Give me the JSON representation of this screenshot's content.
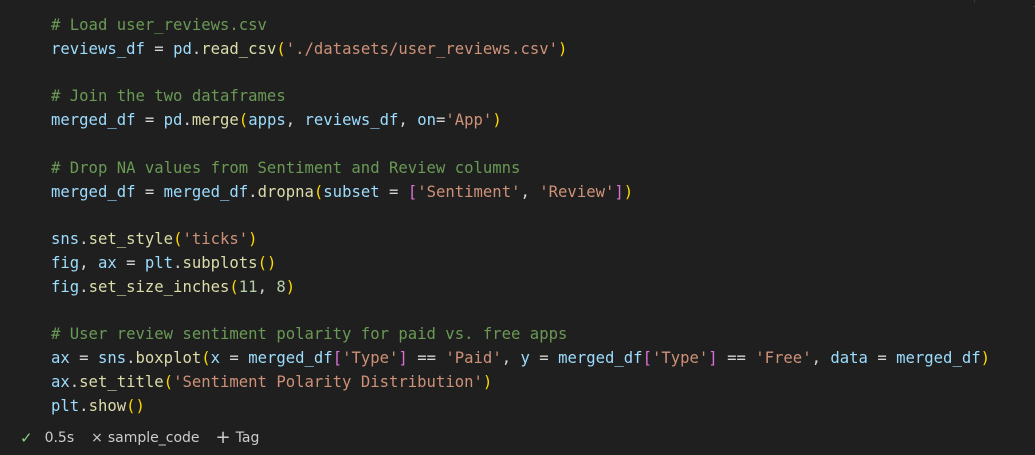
{
  "cell": {
    "code_lines": [
      [
        {
          "t": "# Load user_reviews.csv",
          "c": "comment"
        }
      ],
      [
        {
          "t": "reviews_df",
          "c": "var"
        },
        {
          "t": " = ",
          "c": "op"
        },
        {
          "t": "pd",
          "c": "var"
        },
        {
          "t": ".",
          "c": "op"
        },
        {
          "t": "read_csv",
          "c": "fn"
        },
        {
          "t": "(",
          "c": "p1"
        },
        {
          "t": "'./datasets/user_reviews.csv'",
          "c": "str"
        },
        {
          "t": ")",
          "c": "p1"
        }
      ],
      [],
      [
        {
          "t": "# Join the two dataframes",
          "c": "comment"
        }
      ],
      [
        {
          "t": "merged_df",
          "c": "var"
        },
        {
          "t": " = ",
          "c": "op"
        },
        {
          "t": "pd",
          "c": "var"
        },
        {
          "t": ".",
          "c": "op"
        },
        {
          "t": "merge",
          "c": "fn"
        },
        {
          "t": "(",
          "c": "p1"
        },
        {
          "t": "apps",
          "c": "var"
        },
        {
          "t": ", ",
          "c": "op"
        },
        {
          "t": "reviews_df",
          "c": "var"
        },
        {
          "t": ", ",
          "c": "op"
        },
        {
          "t": "on",
          "c": "var"
        },
        {
          "t": "=",
          "c": "op"
        },
        {
          "t": "'App'",
          "c": "str"
        },
        {
          "t": ")",
          "c": "p1"
        }
      ],
      [],
      [
        {
          "t": "# Drop NA values from Sentiment and Review columns",
          "c": "comment"
        }
      ],
      [
        {
          "t": "merged_df",
          "c": "var"
        },
        {
          "t": " = ",
          "c": "op"
        },
        {
          "t": "merged_df",
          "c": "var"
        },
        {
          "t": ".",
          "c": "op"
        },
        {
          "t": "dropna",
          "c": "fn"
        },
        {
          "t": "(",
          "c": "p1"
        },
        {
          "t": "subset",
          "c": "var"
        },
        {
          "t": " = ",
          "c": "op"
        },
        {
          "t": "[",
          "c": "p2"
        },
        {
          "t": "'Sentiment'",
          "c": "str"
        },
        {
          "t": ", ",
          "c": "op"
        },
        {
          "t": "'Review'",
          "c": "str"
        },
        {
          "t": "]",
          "c": "p2"
        },
        {
          "t": ")",
          "c": "p1"
        }
      ],
      [],
      [
        {
          "t": "sns",
          "c": "var"
        },
        {
          "t": ".",
          "c": "op"
        },
        {
          "t": "set_style",
          "c": "fn"
        },
        {
          "t": "(",
          "c": "p1"
        },
        {
          "t": "'ticks'",
          "c": "str"
        },
        {
          "t": ")",
          "c": "p1"
        }
      ],
      [
        {
          "t": "fig",
          "c": "var"
        },
        {
          "t": ", ",
          "c": "op"
        },
        {
          "t": "ax",
          "c": "var"
        },
        {
          "t": " = ",
          "c": "op"
        },
        {
          "t": "plt",
          "c": "var"
        },
        {
          "t": ".",
          "c": "op"
        },
        {
          "t": "subplots",
          "c": "fn"
        },
        {
          "t": "()",
          "c": "p1"
        }
      ],
      [
        {
          "t": "fig",
          "c": "var"
        },
        {
          "t": ".",
          "c": "op"
        },
        {
          "t": "set_size_inches",
          "c": "fn"
        },
        {
          "t": "(",
          "c": "p1"
        },
        {
          "t": "11",
          "c": "num"
        },
        {
          "t": ", ",
          "c": "op"
        },
        {
          "t": "8",
          "c": "num"
        },
        {
          "t": ")",
          "c": "p1"
        }
      ],
      [],
      [
        {
          "t": "# User review sentiment polarity for paid vs. free apps",
          "c": "comment"
        }
      ],
      [
        {
          "t": "ax",
          "c": "var"
        },
        {
          "t": " = ",
          "c": "op"
        },
        {
          "t": "sns",
          "c": "var"
        },
        {
          "t": ".",
          "c": "op"
        },
        {
          "t": "boxplot",
          "c": "fn"
        },
        {
          "t": "(",
          "c": "p1"
        },
        {
          "t": "x",
          "c": "var"
        },
        {
          "t": " = ",
          "c": "op"
        },
        {
          "t": "merged_df",
          "c": "var"
        },
        {
          "t": "[",
          "c": "p2"
        },
        {
          "t": "'Type'",
          "c": "str"
        },
        {
          "t": "]",
          "c": "p2"
        },
        {
          "t": " == ",
          "c": "op"
        },
        {
          "t": "'Paid'",
          "c": "str"
        },
        {
          "t": ", ",
          "c": "op"
        },
        {
          "t": "y",
          "c": "var"
        },
        {
          "t": " = ",
          "c": "op"
        },
        {
          "t": "merged_df",
          "c": "var"
        },
        {
          "t": "[",
          "c": "p2"
        },
        {
          "t": "'Type'",
          "c": "str"
        },
        {
          "t": "]",
          "c": "p2"
        },
        {
          "t": " == ",
          "c": "op"
        },
        {
          "t": "'Free'",
          "c": "str"
        },
        {
          "t": ", ",
          "c": "op"
        },
        {
          "t": "data",
          "c": "var"
        },
        {
          "t": " = ",
          "c": "op"
        },
        {
          "t": "merged_df",
          "c": "var"
        },
        {
          "t": ")",
          "c": "p1"
        }
      ],
      [
        {
          "t": "ax",
          "c": "var"
        },
        {
          "t": ".",
          "c": "op"
        },
        {
          "t": "set_title",
          "c": "fn"
        },
        {
          "t": "(",
          "c": "p1"
        },
        {
          "t": "'Sentiment Polarity Distribution'",
          "c": "str"
        },
        {
          "t": ")",
          "c": "p1"
        }
      ],
      [
        {
          "t": "plt",
          "c": "var"
        },
        {
          "t": ".",
          "c": "op"
        },
        {
          "t": "show",
          "c": "fn"
        },
        {
          "t": "()",
          "c": "p1"
        }
      ]
    ]
  },
  "status_bar": {
    "check_icon": "✓",
    "exec_time": "0.5s",
    "close_icon": "×",
    "cell_name": "sample_code",
    "plus_icon": "+",
    "tag_label": "Tag"
  },
  "colors": {
    "background": "#1f1f1f",
    "comment": "#6a9955",
    "variable": "#9cdcfe",
    "string": "#ce9178",
    "function": "#dcdcaa",
    "number": "#b5cea8",
    "success": "#89d185"
  }
}
